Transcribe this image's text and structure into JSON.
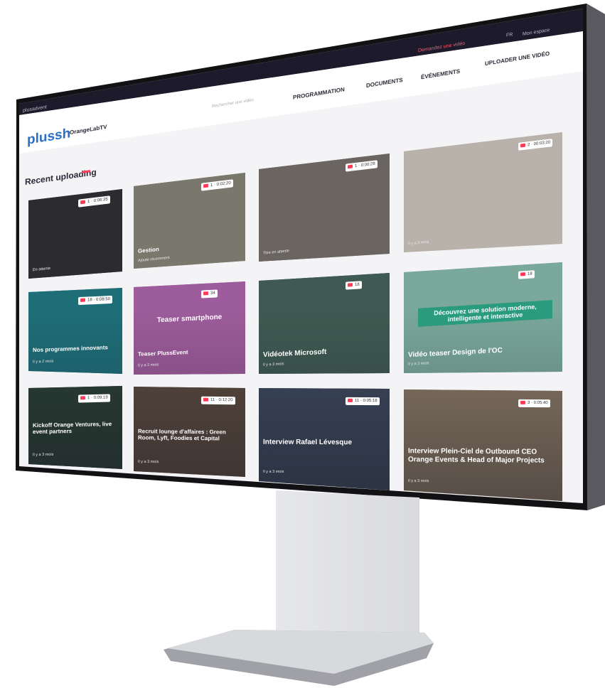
{
  "topbar": {
    "left_text": "plusadvent",
    "record_link": "Demandez une vidéo",
    "lang": "FR",
    "account": "Mon espace"
  },
  "header": {
    "logo": "plussh",
    "brand_suffix": "OrangeLabTV",
    "search_placeholder": "Rechercher une vidéo",
    "nav": [
      "PROGRAMMATION",
      "DOCUMENTS",
      "ÉVÉNEMENTS",
      "UPLOADER UNE VIDÉO"
    ]
  },
  "section": {
    "title": "Recent uploading"
  },
  "cards": [
    {
      "title": "",
      "meta": "En attente",
      "badge": "1 · 0:08:35",
      "bg": "#2c2c30"
    },
    {
      "title": "Gestion",
      "meta": "Ajouté récemment",
      "badge": "1 · 0:02:20",
      "bg": "#7a776d"
    },
    {
      "title": "",
      "meta": "Titre en attente",
      "badge": "1 · 0:00:28",
      "bg": "#6b6562"
    },
    {
      "title": "",
      "meta": "Il y a 3 mois",
      "badge": "2 · 00:03:20",
      "bg": "#b9b2aa"
    },
    {
      "title": "Nos programmes innovants",
      "meta": "Il y a 2 mois",
      "badge": "18 · 0:08:50",
      "bg": "#1e6e78"
    },
    {
      "title": "Teaser PlussEvent",
      "meta": "Il y a 2 mois",
      "badge": "34",
      "bg": "#9d5c9b",
      "overlay": "Teaser smartphone"
    },
    {
      "title": "Vidéotek Microsoft",
      "meta": "Il y a 3 mois",
      "badge": "18",
      "bg": "#3f5a52"
    },
    {
      "title": "Vidéo teaser Design de l'OC",
      "meta": "Il y a 3 mois",
      "badge": "18",
      "bg": "#7aa89b",
      "overlay": "Découvrez une solution moderne, intelligente et interactive"
    },
    {
      "title": "Kickoff Orange Ventures, live event partners",
      "meta": "Il y a 3 mois",
      "badge": "1 · 0:09:19",
      "bg": "#2b3f36"
    },
    {
      "title": "Recruit lounge d'affaires : Green Room, Lyft, Foodies et Capital",
      "meta": "Il y a 3 mois",
      "badge": "11 · 0:12:20",
      "bg": "#5b4b40"
    },
    {
      "title": "Interview Rafael Lévesque",
      "meta": "Il y a 3 mois",
      "badge": "11 · 0:05:18",
      "bg": "#3d4a5e"
    },
    {
      "title": "Interview Plein-Ciel de Outbound CEO Orange Events & Head of Major Projects",
      "meta": "Il y a 3 mois",
      "badge": "3 · 0:05:40",
      "bg": "#8a7a66"
    }
  ]
}
